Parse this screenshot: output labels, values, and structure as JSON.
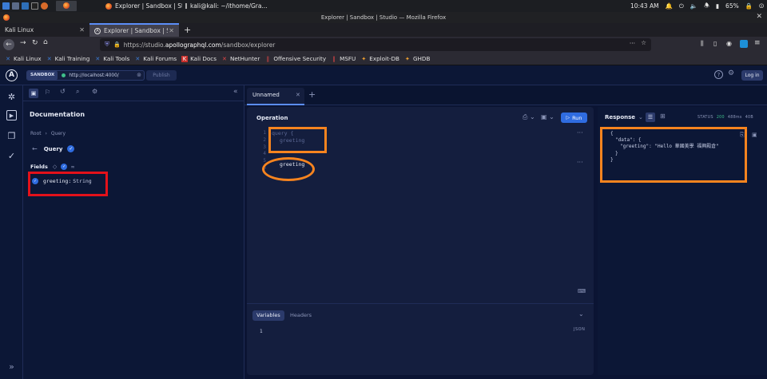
{
  "taskbar": {
    "item_firefox": "Explorer | Sandbox | Stu...",
    "item_terminal": "kali@kali: ~/ithome/Gra...",
    "clock": "10:43 AM",
    "battery": "65%"
  },
  "browser": {
    "window_title": "Explorer | Sandbox | Studio — Mozilla Firefox",
    "tabs": [
      {
        "label": "Kali Linux"
      },
      {
        "label": "Explorer | Sandbox | Studi"
      }
    ],
    "new_tab": "+",
    "url_prefix": "https://studio.",
    "url_domain": "apollographql.com",
    "url_path": "/sandbox/explorer",
    "bookmarks": [
      "Kali Linux",
      "Kali Training",
      "Kali Tools",
      "Kali Forums",
      "Kali Docs",
      "NetHunter",
      "Offensive Security",
      "MSFU",
      "Exploit-DB",
      "GHDB"
    ]
  },
  "header": {
    "sandbox_badge": "SANDBOX",
    "endpoint": "http://localhost:4000/",
    "publish": "Publish",
    "login": "Log in"
  },
  "docs": {
    "title": "Documentation",
    "breadcrumb_root": "Root",
    "breadcrumb_sep": "›",
    "breadcrumb_current": "Query",
    "type_name": "Query",
    "fields_label": "Fields",
    "field_name": "greeting",
    "field_sep": ":",
    "field_type": "String"
  },
  "editor": {
    "tab_label": "Unnamed",
    "section_title": "Operation",
    "run_label": "Run",
    "line_numbers": [
      "1",
      "2",
      "3",
      "4",
      "5",
      "6"
    ],
    "line1": "query {",
    "line2": "greeting",
    "line5": "greeting",
    "variables_tab": "Variables",
    "headers_tab": "Headers",
    "var_line": "1",
    "json_label": "JSON"
  },
  "response": {
    "title": "Response",
    "status_label": "STATUS",
    "status_code": "200",
    "time": "488ms",
    "size": "40B",
    "line_open": "{",
    "line_data": "\"data\": {",
    "line_greeting_key": "\"greeting\":",
    "line_greeting_val": "\"Hello 華國美學 福興殿倉\"",
    "line_close_inner": "}",
    "line_close": "}"
  },
  "colors": {
    "annotation_orange": "#f7841f",
    "annotation_red": "#e3111a",
    "run_button": "#2f6ce0",
    "status_green": "#3fbf8a"
  }
}
